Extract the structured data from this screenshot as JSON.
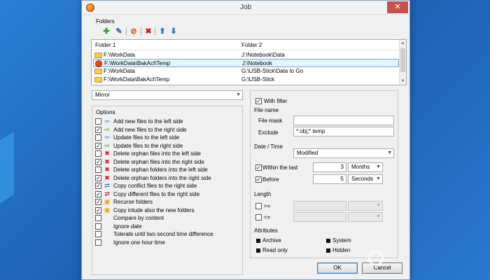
{
  "window": {
    "title": "Job",
    "close": "✕"
  },
  "folders": {
    "label": "Folders",
    "col1": "Folder 1",
    "col2": "Folder 2",
    "rows": [
      {
        "f1": "F:\\WorkData",
        "f2": "J:\\Notebook\\Data"
      },
      {
        "f1": "F:\\WorkData\\BakAct\\Temp",
        "f2": "J:\\Notebook"
      },
      {
        "f1": "F:\\WorkData",
        "f2": "G:\\USB-Stick\\Data to Go"
      },
      {
        "f1": "F:\\WorkData\\BakAct\\Temp",
        "f2": "G:\\USB-Stick"
      }
    ]
  },
  "toolbar": {
    "add": "✚",
    "edit": "✎",
    "noentry": "⊘",
    "delete": "✖",
    "up": "⬆",
    "down": "⬇"
  },
  "mode": {
    "value": "Mirror"
  },
  "options": {
    "label": "Options",
    "items": [
      {
        "label": "Add new files to the left side",
        "checked": ""
      },
      {
        "label": "Add new files to the right side",
        "checked": "✓"
      },
      {
        "label": "Update files to the left side",
        "checked": ""
      },
      {
        "label": "Update files to the right side",
        "checked": "✓"
      },
      {
        "label": "Delete orphan files into the left side",
        "checked": ""
      },
      {
        "label": "Delete orphan files into the right side",
        "checked": "✓"
      },
      {
        "label": "Delete orphan folders into the left side",
        "checked": ""
      },
      {
        "label": "Delete orphan folders into the right side",
        "checked": "✓"
      },
      {
        "label": "Copy conflict files to the right side",
        "checked": "✓"
      },
      {
        "label": "Copy different files to the right side",
        "checked": "✓"
      },
      {
        "label": "Recurse folders",
        "checked": "✓"
      },
      {
        "label": "Copy inlude also the new folders",
        "checked": "✓"
      },
      {
        "label": "Compare by content",
        "checked": ""
      },
      {
        "label": "Ignore date",
        "checked": ""
      },
      {
        "label": "Tolerate until two second time difference",
        "checked": ""
      },
      {
        "label": "Ignore one hour time",
        "checked": ""
      }
    ]
  },
  "filter": {
    "with_filter": "With filter",
    "with_filter_checked": "✓",
    "file_name_label": "File name",
    "file_mask_label": "File mask",
    "file_mask_value": "",
    "exclude_label": "Exclude",
    "exclude_value": "*.obj;*.temp",
    "date_time_label": "Date / Time",
    "date_mode": "Modified",
    "within_label": "Within the last",
    "within_checked": "✓",
    "within_value": "3",
    "within_unit": "Months",
    "before_label": "Before",
    "before_checked": "✓",
    "before_value": "5",
    "before_unit": "Seconds",
    "length_label": "Length",
    "ge_label": ">=",
    "le_label": "<=",
    "attributes_label": "Attributes",
    "archive": "Archive",
    "system": "System",
    "readonly": "Read only",
    "hidden": "Hidden"
  },
  "buttons": {
    "ok": "OK",
    "cancel": "Cancel"
  },
  "watermark": "esk op"
}
